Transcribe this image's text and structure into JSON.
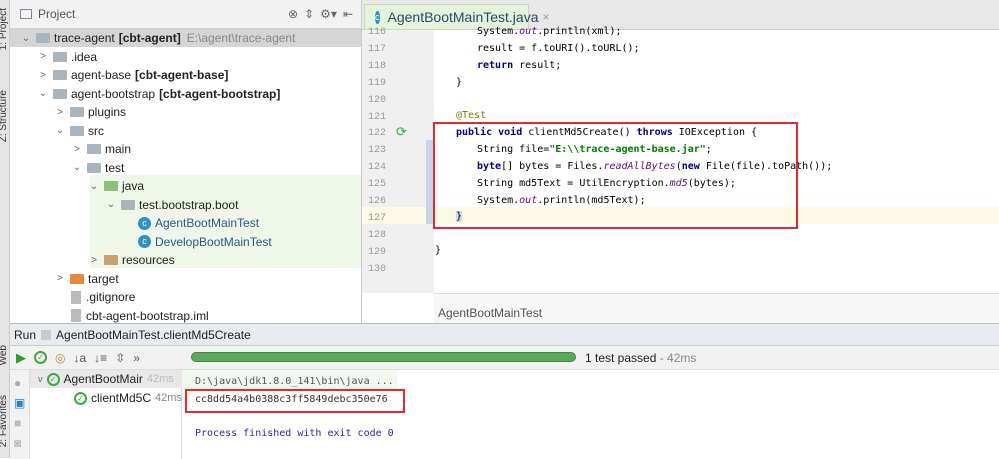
{
  "side_tabs": {
    "project": "1: Project",
    "structure": "Z: Structure",
    "web": "Web",
    "favorites": "2: Favorites"
  },
  "project": {
    "title": "Project",
    "tree": [
      {
        "label": "trace-agent",
        "module": "[cbt-agent]",
        "path": "E:\\agent\\trace-agent",
        "depth": 0,
        "arrow": "v",
        "icon": "module"
      },
      {
        "label": ".idea",
        "depth": 1,
        "arrow": ">",
        "icon": "folder"
      },
      {
        "label": "agent-base",
        "module": "[cbt-agent-base]",
        "depth": 1,
        "arrow": ">",
        "icon": "module"
      },
      {
        "label": "agent-bootstrap",
        "module": "[cbt-agent-bootstrap]",
        "depth": 1,
        "arrow": "v",
        "icon": "module"
      },
      {
        "label": "plugins",
        "depth": 2,
        "arrow": ">",
        "icon": "folder"
      },
      {
        "label": "src",
        "depth": 2,
        "arrow": "v",
        "icon": "folder"
      },
      {
        "label": "main",
        "depth": 3,
        "arrow": ">",
        "icon": "folder"
      },
      {
        "label": "test",
        "depth": 3,
        "arrow": "v",
        "icon": "folder"
      },
      {
        "label": "java",
        "depth": 4,
        "arrow": "v",
        "icon": "src"
      },
      {
        "label": "test.bootstrap.boot",
        "depth": 5,
        "arrow": "v",
        "icon": "folder"
      },
      {
        "label": "AgentBootMainTest",
        "depth": 6,
        "arrow": "",
        "icon": "class"
      },
      {
        "label": "DevelopBootMainTest",
        "depth": 6,
        "arrow": "",
        "icon": "class"
      },
      {
        "label": "resources",
        "depth": 4,
        "arrow": ">",
        "icon": "res"
      },
      {
        "label": "target",
        "depth": 2,
        "arrow": ">",
        "icon": "org"
      },
      {
        "label": ".gitignore",
        "depth": 2,
        "arrow": "",
        "icon": "file"
      },
      {
        "label": "cbt-agent-bootstrap.iml",
        "depth": 2,
        "arrow": "",
        "icon": "file"
      }
    ]
  },
  "editor": {
    "tab": "AgentBootMainTest.java",
    "close": "×",
    "breadcrumb": "AgentBootMainTest",
    "line_numbers": [
      "116",
      "117",
      "118",
      "119",
      "120",
      "121",
      "122",
      "123",
      "124",
      "125",
      "126",
      "127",
      "128",
      "129",
      "130"
    ],
    "lines": {
      "l116a": "System.",
      "l116b": "out",
      "l116c": ".println(xml);",
      "l117": "result = f.toURI().toURL();",
      "l118a": "return",
      "l118b": " result;",
      "l119": "}",
      "l121": "@Test",
      "l122a": "public void",
      "l122b": " clientMd5Create() ",
      "l122c": "throws",
      "l122d": " IOException {",
      "l123a": "String file=",
      "l123b": "\"E:\\\\trace-agent-base.jar\"",
      "l123c": ";",
      "l124a": "byte",
      "l124b": "[] bytes = Files.",
      "l124c": "readAllBytes",
      "l124d": "(",
      "l124e": "new",
      "l124f": " File(file).toPath());",
      "l125a": "String md5Text = UtilEncryption.",
      "l125b": "md5",
      "l125c": "(bytes);",
      "l126a": "System.",
      "l126b": "out",
      "l126c": ".println(md5Text);",
      "l127": "}",
      "l129": "}"
    }
  },
  "run": {
    "label": "Run",
    "config": "AgentBootMainTest.clientMd5Create",
    "status": "1 test passed",
    "time": " - 42ms",
    "progress": 1.0,
    "tree": [
      {
        "label": "AgentBootMair",
        "time": "42ms"
      },
      {
        "label": "clientMd5C",
        "time": "42ms"
      }
    ],
    "console": [
      "D:\\java\\jdk1.8.0_141\\bin\\java ...",
      "cc8dd54a4b0388c3ff5849debc350e76",
      "Process finished with exit code 0"
    ]
  },
  "colors": {
    "highlight_box": "#e8282b",
    "progress": "#5aaa5a"
  }
}
